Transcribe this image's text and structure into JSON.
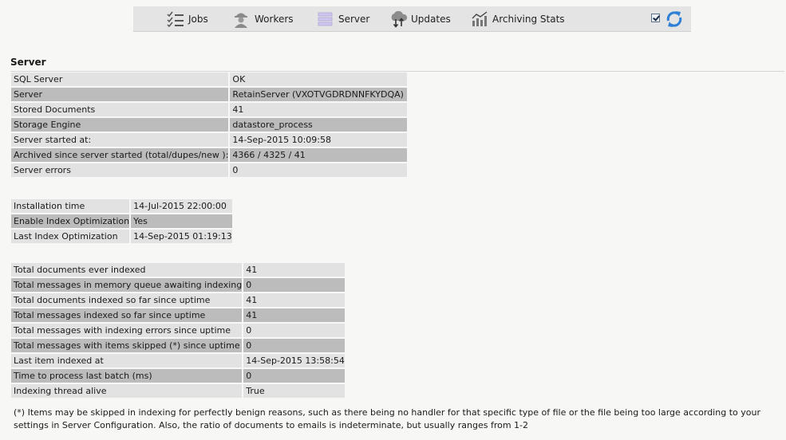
{
  "toolbar": {
    "jobs_label": "Jobs",
    "workers_label": "Workers",
    "server_label": "Server",
    "updates_label": "Updates",
    "archiving_label": "Archiving Stats",
    "auto_refresh_checked": true
  },
  "server": {
    "title": "Server",
    "status": [
      {
        "k": "SQL Server",
        "v": "OK"
      },
      {
        "k": "Server",
        "v": "RetainServer (VXOTVGDRDNNFKYDQA)"
      },
      {
        "k": "Stored Documents",
        "v": "41"
      },
      {
        "k": "Storage Engine",
        "v": "datastore_process"
      },
      {
        "k": "Server started at:",
        "v": "14-Sep-2015 10:09:58"
      },
      {
        "k": "Archived since server started (total/dupes/new ):",
        "v": "4366 / 4325 / 41"
      },
      {
        "k": "Server errors",
        "v": "0"
      }
    ],
    "index": [
      {
        "k": "Installation time",
        "v": "14-Jul-2015 22:00:00"
      },
      {
        "k": "Enable Index Optimization",
        "v": "Yes"
      },
      {
        "k": "Last Index Optimization",
        "v": "14-Sep-2015 01:19:13"
      }
    ],
    "indexing": [
      {
        "k": "Total documents ever indexed",
        "v": "41"
      },
      {
        "k": "Total messages in memory queue awaiting indexing",
        "v": "0"
      },
      {
        "k": "Total documents indexed so far since uptime",
        "v": "41"
      },
      {
        "k": "Total messages indexed so far since uptime",
        "v": "41"
      },
      {
        "k": "Total messages with indexing errors since uptime",
        "v": "0"
      },
      {
        "k": "Total messages with items skipped (*) since uptime",
        "v": "0"
      },
      {
        "k": "Last item indexed at",
        "v": "14-Sep-2015 13:58:54"
      },
      {
        "k": "Time to process last batch (ms)",
        "v": "0"
      },
      {
        "k": "Indexing thread alive",
        "v": "True"
      }
    ],
    "footnote": "(*) Items may be skipped in indexing for perfectly benign reasons, such as there being no handler for that specific type of file or the file being too large according to your settings in Server Configuration. Also, the ratio of documents to emails is indeterminate, but usually ranges from 1-2"
  },
  "colors": {
    "row_light": "#e2e2e2",
    "row_dark": "#bcbcbc",
    "toolbar_bg": "#e4e4e4",
    "refresh_blue": "#2e7fd6"
  }
}
